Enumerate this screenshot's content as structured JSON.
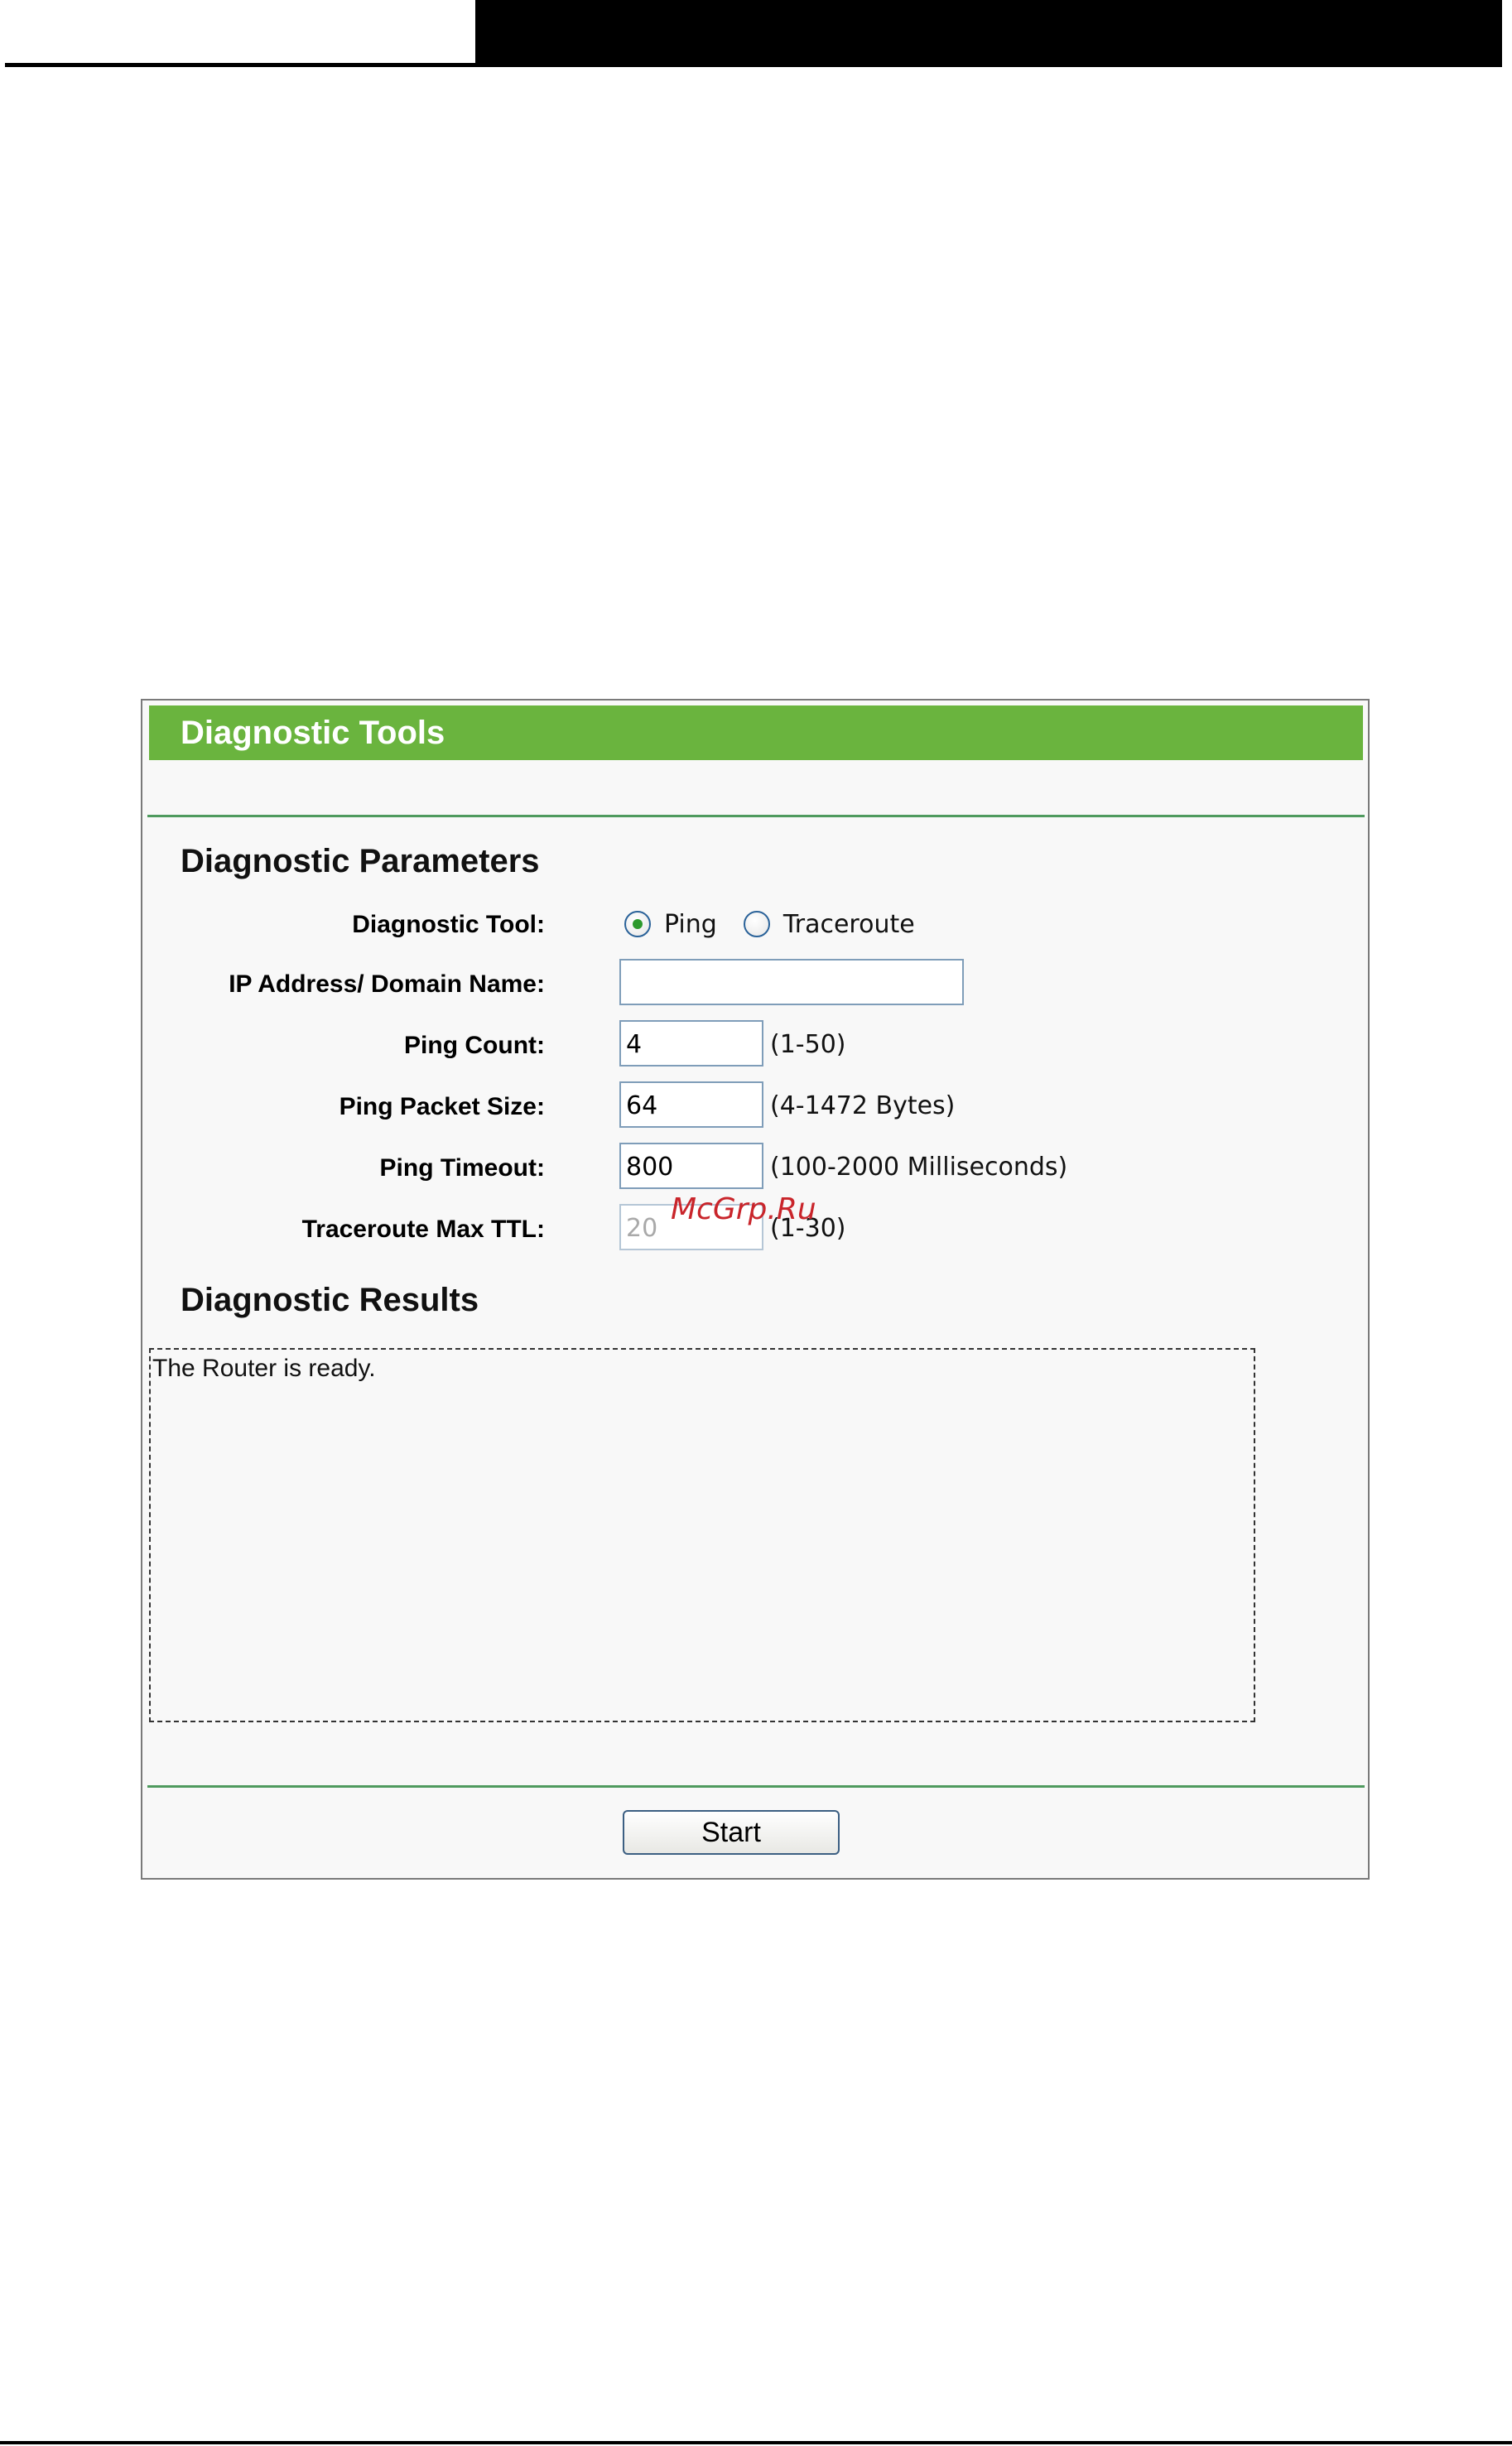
{
  "panel": {
    "title": "Diagnostic Tools"
  },
  "params": {
    "heading": "Diagnostic Parameters",
    "diagnostic_tool": {
      "label": "Diagnostic Tool:",
      "options": [
        "Ping",
        "Traceroute"
      ],
      "selected": "Ping"
    },
    "ip_address": {
      "label": "IP Address/ Domain Name:",
      "value": ""
    },
    "ping_count": {
      "label": "Ping Count:",
      "value": "4",
      "hint": "(1-50)"
    },
    "ping_packet_size": {
      "label": "Ping Packet Size:",
      "value": "64",
      "hint": "(4-1472 Bytes)"
    },
    "ping_timeout": {
      "label": "Ping Timeout:",
      "value": "800",
      "hint": "(100-2000 Milliseconds)"
    },
    "traceroute_max_ttl": {
      "label": "Traceroute Max TTL:",
      "value": "20",
      "hint": "(1-30)",
      "disabled": true
    }
  },
  "watermark": "McGrp.Ru",
  "results": {
    "heading": "Diagnostic Results",
    "text": "The Router is ready."
  },
  "actions": {
    "start_label": "Start"
  },
  "colors": {
    "title_bar": "#6ab43e",
    "divider": "#4f9a5e",
    "panel_bg": "#f8f8f8",
    "input_border": "#7f9db9",
    "radio_dot": "#2d9a2d",
    "watermark": "#c9252b"
  }
}
